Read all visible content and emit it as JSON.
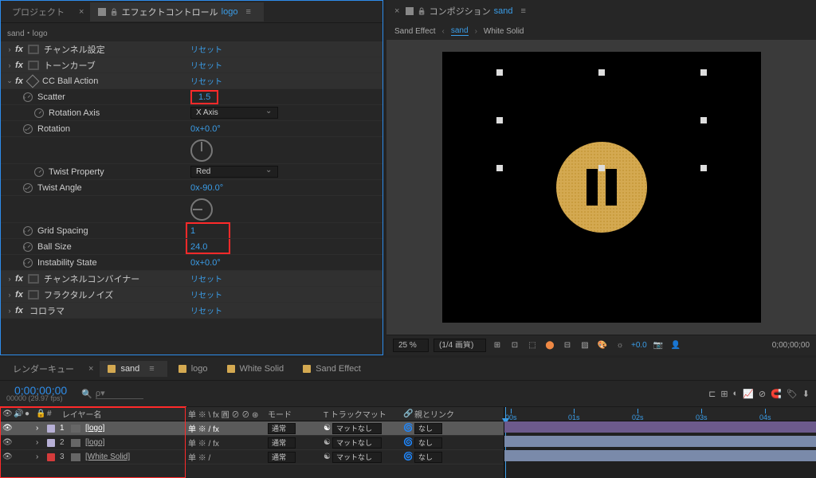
{
  "leftPanel": {
    "tabs": {
      "project": "プロジェクト",
      "ecPrefix": "エフェクトコントロール",
      "ecTarget": "logo"
    },
    "breadcrumb": "sand・logo",
    "effects": [
      {
        "name": "チャンネル設定",
        "reset": "リセット"
      },
      {
        "name": "トーンカーブ",
        "reset": "リセット"
      }
    ],
    "ballAction": {
      "name": "CC Ball Action",
      "reset": "リセット",
      "scatter": {
        "label": "Scatter",
        "value": "1.5"
      },
      "rotationAxis": {
        "label": "Rotation Axis",
        "value": "X Axis"
      },
      "rotation": {
        "label": "Rotation",
        "value": "0x+0.0°"
      },
      "twistProperty": {
        "label": "Twist Property",
        "value": "Red"
      },
      "twistAngle": {
        "label": "Twist Angle",
        "value": "0x-90.0°"
      },
      "gridSpacing": {
        "label": "Grid Spacing",
        "value": "1"
      },
      "ballSize": {
        "label": "Ball Size",
        "value": "24.0"
      },
      "instability": {
        "label": "Instability State",
        "value": "0x+0.0°"
      }
    },
    "moreEffects": [
      {
        "name": "チャンネルコンバイナー",
        "reset": "リセット"
      },
      {
        "name": "フラクタルノイズ",
        "reset": "リセット"
      },
      {
        "name": "コロラマ",
        "reset": "リセット"
      }
    ]
  },
  "compPanel": {
    "tabPrefix": "コンポジション",
    "tabTarget": "sand",
    "breadcrumb": [
      "Sand Effect",
      "sand",
      "White Solid"
    ],
    "footer": {
      "zoom": "25 %",
      "quality": "(1/4 画質)",
      "exposure": "+0.0",
      "timecode": "0;00;00;00"
    }
  },
  "timeline": {
    "renderQueue": "レンダーキュー",
    "tabs": [
      {
        "label": "sand",
        "color": "#d4a951",
        "active": true
      },
      {
        "label": "logo",
        "color": "#d4a951"
      },
      {
        "label": "White Solid",
        "color": "#d4a951"
      },
      {
        "label": "Sand Effect",
        "color": "#d4a951"
      }
    ],
    "timecode": "0;00;00;00",
    "fps": "00000 (29.97 fps)",
    "searchPlaceholder": "ρ▾",
    "columns": {
      "layerName": "レイヤー名",
      "switches": "单 ※ \\ fx 圓 ⊘ ⊘ ⊛",
      "mode": "モード",
      "trackMatte": "T トラックマット",
      "parent": "親とリンク"
    },
    "layers": [
      {
        "num": "1",
        "color": "#b7b0d6",
        "name": "[logo]",
        "switches": "单 ※ / fx",
        "mode": "通常",
        "matte": "マットなし",
        "parent": "なし",
        "sel": true
      },
      {
        "num": "2",
        "color": "#b7b0d6",
        "name": "[logo]",
        "switches": "单 ※ / fx",
        "mode": "通常",
        "matte": "マットなし",
        "parent": "なし"
      },
      {
        "num": "3",
        "color": "#d43b3b",
        "name": "[White Solid]",
        "switches": "单 ※ /",
        "mode": "通常",
        "matte": "マットなし",
        "parent": "なし"
      }
    ],
    "ticks": [
      "00s",
      "01s",
      "02s",
      "03s",
      "04s"
    ]
  }
}
